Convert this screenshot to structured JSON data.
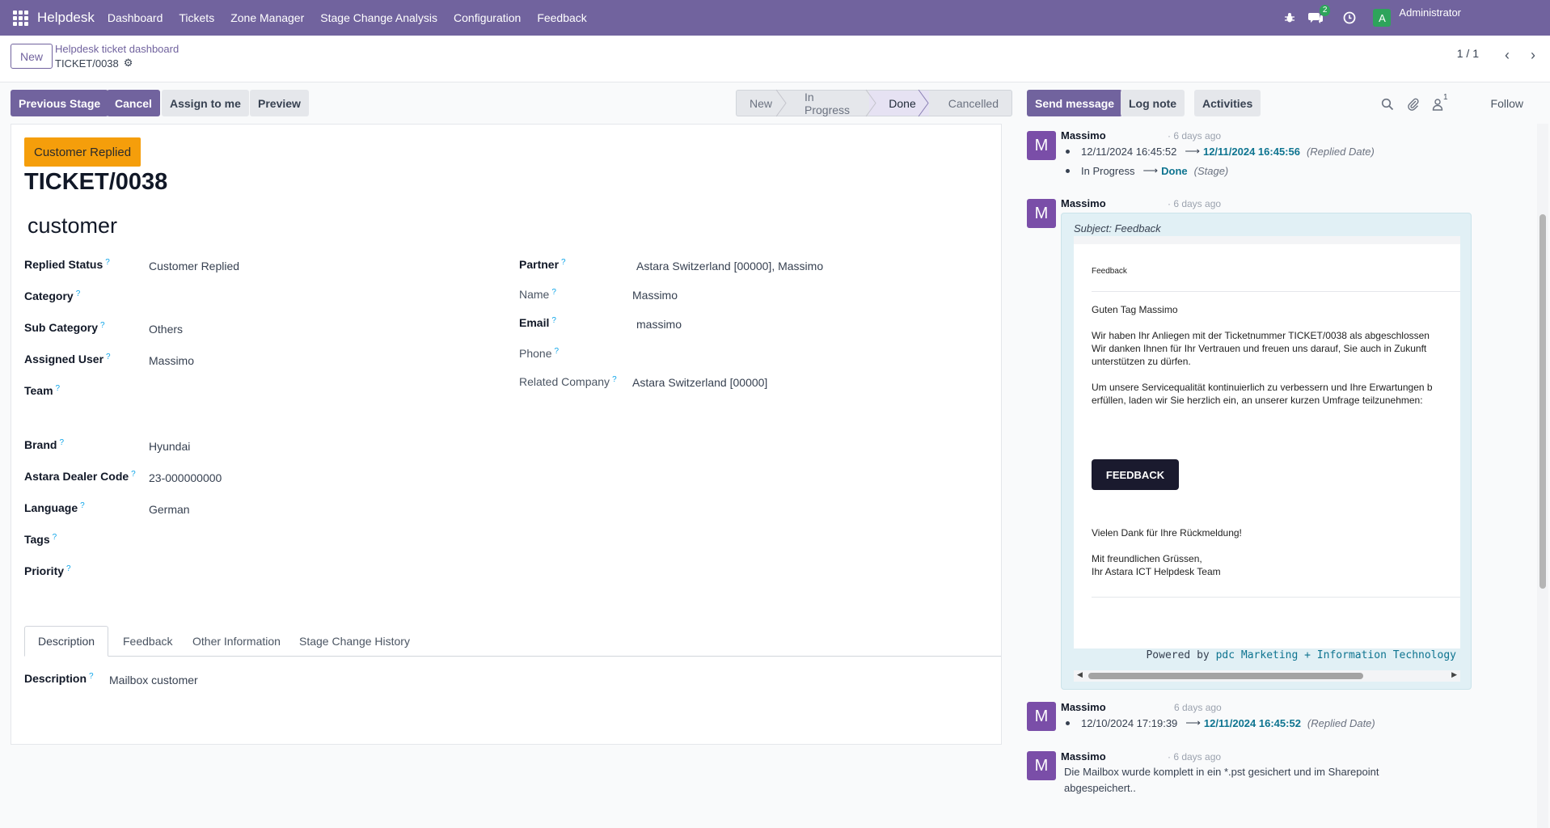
{
  "navbar": {
    "app_name": "Helpdesk",
    "menu": [
      "Dashboard",
      "Tickets",
      "Zone Manager",
      "Stage Change Analysis",
      "Configuration",
      "Feedback"
    ],
    "chat_badge": "2",
    "user_initial": "A",
    "user_name": "Administrator"
  },
  "control": {
    "new_label": "New",
    "breadcrumb_parent": "Helpdesk ticket dashboard",
    "breadcrumb_current": "TICKET/0038",
    "pager": "1 / 1"
  },
  "statusbar": {
    "buttons": [
      "Previous Stage",
      "Cancel",
      "Assign to me",
      "Preview"
    ],
    "stages": [
      "New",
      "In Progress",
      "Done",
      "Cancelled"
    ],
    "active_stage": "Done"
  },
  "form": {
    "ribbon": "Customer Replied",
    "ticket_number": "TICKET/0038",
    "subject": "customer",
    "left_fields": [
      {
        "label": "Replied Status",
        "value": "Customer Replied"
      },
      {
        "label": "Category",
        "value": ""
      },
      {
        "label": "Sub Category",
        "value": "Others"
      },
      {
        "label": "Assigned User",
        "value": "Massimo"
      },
      {
        "label": "Team",
        "value": ""
      },
      {
        "label": "Brand",
        "value": "Hyundai"
      },
      {
        "label": "Astara Dealer Code",
        "value": "23-000000000"
      },
      {
        "label": "Language",
        "value": "German"
      },
      {
        "label": "Tags",
        "value": ""
      },
      {
        "label": "Priority",
        "value": ""
      }
    ],
    "right_fields": [
      {
        "label": "Partner",
        "value": "Astara Switzerland [00000], Massimo"
      },
      {
        "label": "Name",
        "value": "Massimo"
      },
      {
        "label": "Email",
        "value": "massimo"
      },
      {
        "label": "Phone",
        "value": ""
      },
      {
        "label": "Related Company",
        "value": "Astara Switzerland [00000]"
      }
    ],
    "tabs": [
      "Description",
      "Feedback",
      "Other Information",
      "Stage Change History"
    ],
    "description_label": "Description",
    "description_value": "Mailbox customer"
  },
  "chatter": {
    "send_message": "Send message",
    "log_note": "Log note",
    "activities": "Activities",
    "attachments_count": "1",
    "follow": "Follow",
    "messages": [
      {
        "avatar": "M",
        "author": "Massimo",
        "ago": "· 6 days ago",
        "tracking": [
          {
            "old": "12/11/2024 16:45:52",
            "new": "12/11/2024 16:45:56",
            "field": "(Replied Date)"
          },
          {
            "old": "In Progress",
            "new": "Done",
            "field": "(Stage)"
          }
        ]
      },
      {
        "avatar": "M",
        "author": "Massimo",
        "ago": "· 6 days ago",
        "subject": "Subject: Feedback",
        "mail": {
          "header": "Feedback",
          "greeting": "Guten Tag Massimo",
          "p1_l1": "Wir haben Ihr Anliegen mit der Ticketnummer TICKET/0038 als abgeschlossen",
          "p1_l2": "Wir danken Ihnen für Ihr Vertrauen und freuen uns darauf, Sie auch in Zukunft",
          "p1_l3": "unterstützen zu dürfen.",
          "p2_l1": "Um unsere Servicequalität kontinuierlich zu verbessern und Ihre Erwartungen b",
          "p2_l2": "erfüllen, laden wir Sie herzlich ein, an unserer kurzen Umfrage teilzunehmen:",
          "button": "FEEDBACK",
          "thanks": "Vielen Dank für Ihre Rückmeldung!",
          "closing_l1": "Mit freundlichen Grüssen,",
          "closing_l2": "Ihr Astara ICT Helpdesk Team",
          "powered_prefix": "Powered by",
          "powered_link": "pdc Marketing + Information Technology"
        }
      },
      {
        "avatar": "M",
        "author": "Massimo",
        "ago": "6 days ago",
        "tracking": [
          {
            "old": "12/10/2024 17:19:39",
            "new": "12/11/2024 16:45:52",
            "field": "(Replied Date)"
          }
        ]
      },
      {
        "avatar": "M",
        "author": "Massimo",
        "ago": "· 6 days ago",
        "body_l1": "Die Mailbox wurde komplett in ein *.pst gesichert und im Sharepoint",
        "body_l2": "abgespeichert.."
      }
    ]
  },
  "colors": {
    "brand": "#71639e",
    "ribbon": "#f59e0b",
    "avatar": "#7a4ea8",
    "tracking_new": "#0e7490"
  }
}
